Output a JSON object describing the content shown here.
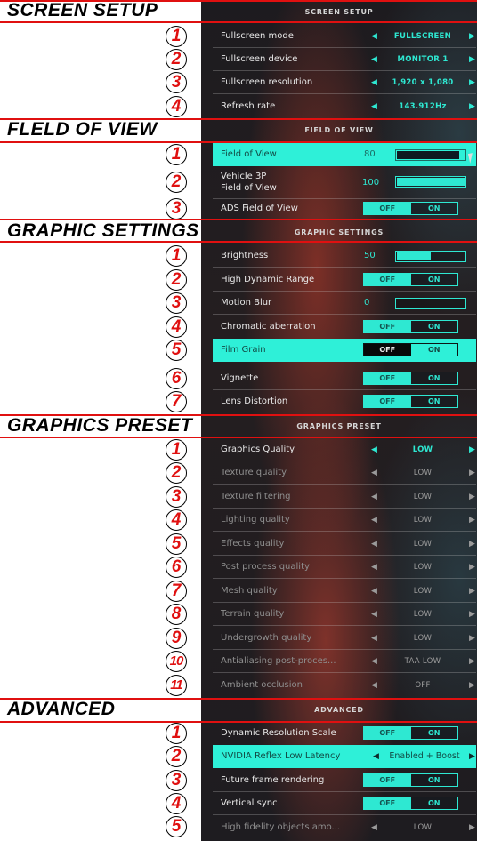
{
  "colors": {
    "accent": "#2ef0d8",
    "annotation_red": "#e01010",
    "annotation_line": "#e01010"
  },
  "sections": {
    "screen_setup": {
      "left_title": "SCREEN SETUP",
      "title": "SCREEN SETUP",
      "rows": [
        {
          "num": "1",
          "label": "Fullscreen mode",
          "value": "FULLSCREEN"
        },
        {
          "num": "2",
          "label": "Fullscreen device",
          "value": "MONITOR 1"
        },
        {
          "num": "3",
          "label": "Fullscreen resolution",
          "value": "1,920 x 1,080"
        },
        {
          "num": "4",
          "label": "Refresh rate",
          "value": "143.912Hz"
        }
      ]
    },
    "field_of_view": {
      "left_title": "FLELD OF VIEW",
      "title": "FIELD OF VIEW",
      "rows": [
        {
          "num": "1",
          "label": "Field of View",
          "value": "80",
          "slider_fraction": 0.92,
          "highlighted": true
        },
        {
          "num": "2",
          "label_line1": "Vehicle 3P",
          "label_line2": "Field of View",
          "value": "100",
          "slider_fraction": 1.0
        },
        {
          "num": "3",
          "label": "ADS Field of View",
          "off": "OFF",
          "on": "ON",
          "state": "OFF"
        }
      ]
    },
    "graphic_settings": {
      "left_title": "GRAPHIC SETTINGS",
      "title": "GRAPHIC SETTINGS",
      "rows": [
        {
          "num": "1",
          "label": "Brightness",
          "value": "50",
          "slider_fraction": 0.5
        },
        {
          "num": "2",
          "label": "High Dynamic Range",
          "off": "OFF",
          "on": "ON",
          "state": "OFF"
        },
        {
          "num": "3",
          "label": "Motion Blur",
          "value": "0",
          "slider_fraction": 0.0
        },
        {
          "num": "4",
          "label": "Chromatic aberration",
          "off": "OFF",
          "on": "ON",
          "state": "OFF"
        },
        {
          "num": "5",
          "label": "Film Grain",
          "off": "OFF",
          "on": "ON",
          "state": "OFF",
          "highlighted": true
        },
        {
          "num": "6",
          "label": "Vignette",
          "off": "OFF",
          "on": "ON",
          "state": "OFF"
        },
        {
          "num": "7",
          "label": "Lens Distortion",
          "off": "OFF",
          "on": "ON",
          "state": "OFF"
        }
      ]
    },
    "graphics_preset": {
      "left_title": "GRAPHICS PRESET",
      "title": "GRAPHICS PRESET",
      "rows": [
        {
          "num": "1",
          "label": "Graphics Quality",
          "value": "LOW"
        },
        {
          "num": "2",
          "label": "Texture quality",
          "value": "LOW"
        },
        {
          "num": "3",
          "label": "Texture filtering",
          "value": "LOW"
        },
        {
          "num": "4",
          "label": "Lighting quality",
          "value": "LOW"
        },
        {
          "num": "5",
          "label": "Effects quality",
          "value": "LOW"
        },
        {
          "num": "6",
          "label": "Post process quality",
          "value": "LOW"
        },
        {
          "num": "7",
          "label": "Mesh quality",
          "value": "LOW"
        },
        {
          "num": "8",
          "label": "Terrain quality",
          "value": "LOW"
        },
        {
          "num": "9",
          "label": "Undergrowth quality",
          "value": "LOW"
        },
        {
          "num": "10",
          "label": "Antialiasing post-proces...",
          "value": "TAA LOW"
        },
        {
          "num": "11",
          "label": "Ambient occlusion",
          "value": "OFF"
        }
      ]
    },
    "advanced": {
      "left_title": "ADVANCED",
      "title": "ADVANCED",
      "rows": [
        {
          "num": "1",
          "label": "Dynamic Resolution Scale",
          "off": "OFF",
          "on": "ON",
          "state": "OFF"
        },
        {
          "num": "2",
          "label": "NVIDIA Reflex Low Latency",
          "value": "Enabled + Boost",
          "highlighted": true
        },
        {
          "num": "3",
          "label": "Future frame rendering",
          "off": "OFF",
          "on": "ON",
          "state": "OFF"
        },
        {
          "num": "4",
          "label": "Vertical sync",
          "off": "OFF",
          "on": "ON",
          "state": "OFF"
        },
        {
          "num": "5",
          "label": "High fidelity objects amo...",
          "value": "LOW"
        }
      ]
    }
  }
}
